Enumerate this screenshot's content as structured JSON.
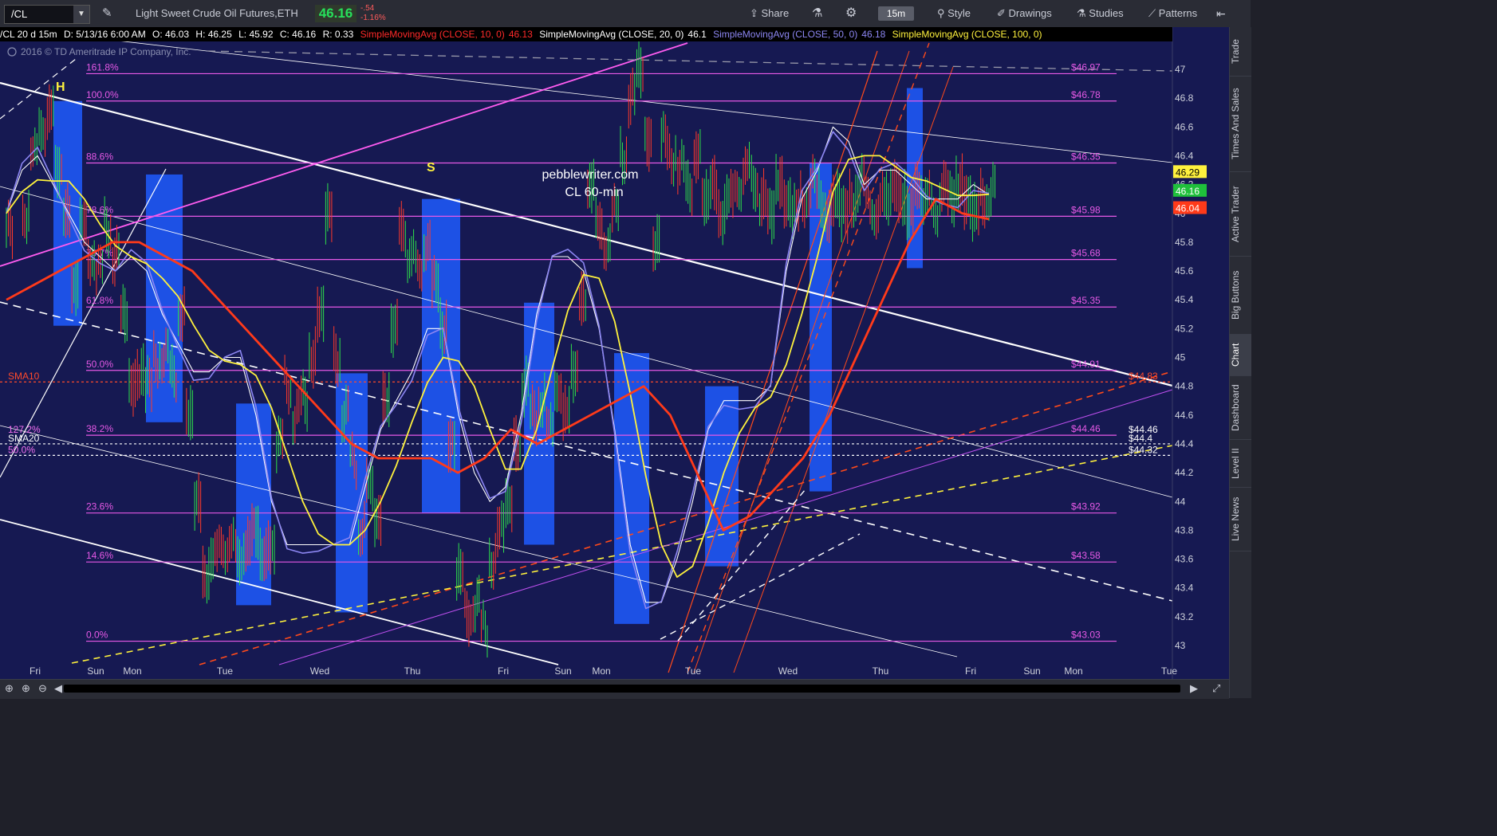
{
  "toolbar": {
    "symbol": "/CL",
    "instrument": "Light Sweet Crude Oil Futures,ETH",
    "last_price": "46.16",
    "net_change": "-.54",
    "pct_change": "-1.16%",
    "share": "Share",
    "timeframe": "15m",
    "style": "Style",
    "drawings": "Drawings",
    "studies": "Studies",
    "patterns": "Patterns"
  },
  "legend": {
    "header": "/CL 20 d 15m",
    "date": "D: 5/13/16 6:00 AM",
    "open": "O: 46.03",
    "high": "H: 46.25",
    "low": "L: 45.92",
    "close": "C: 46.16",
    "range": "R: 0.33",
    "studies": [
      {
        "label": "SimpleMovingAvg (CLOSE, 10, 0)",
        "value": "46.13",
        "color": "#ff2a2a"
      },
      {
        "label": "SimpleMovingAvg (CLOSE, 20, 0)",
        "value": "46.1",
        "color": "#ffffff"
      },
      {
        "label": "SimpleMovingAvg (CLOSE, 50, 0)",
        "value": "46.18",
        "color": "#8c86f2"
      },
      {
        "label": "SimpleMovingAvg (CLOSE, 100, 0)",
        "value": "",
        "color": "#fff23d"
      }
    ]
  },
  "watermark": "2016 © TD Ameritrade IP Company, Inc.",
  "chart_data": {
    "type": "line",
    "title": "pebblewriter.com",
    "subtitle": "CL 60-min",
    "xlabels": [
      "Fri",
      "Sun",
      "Mon",
      "Tue",
      "Wed",
      "Thu",
      "Fri",
      "Sun",
      "Mon",
      "Tue",
      "Wed",
      "Thu",
      "Fri",
      "Sun",
      "Mon",
      "Tue"
    ],
    "ylim": [
      42.85,
      47.25
    ],
    "yticks": [
      43,
      43.2,
      43.4,
      43.6,
      43.8,
      44,
      44.2,
      44.4,
      44.6,
      44.8,
      45,
      45.2,
      45.4,
      45.6,
      45.8,
      46,
      46.2,
      46.4,
      46.6,
      46.8,
      47
    ],
    "price_path_x": [
      0,
      1,
      1.5,
      2,
      2.5,
      3,
      3.5,
      4,
      4.5,
      5,
      5.5,
      6,
      6.5,
      7,
      7.5,
      8,
      8.5,
      9,
      9.5,
      10,
      10.5,
      11,
      11.5,
      12,
      12.5,
      13,
      13.5,
      14,
      14.5,
      15,
      15.5,
      16,
      16.5,
      17,
      17.5,
      18,
      18.5,
      19,
      19.5,
      20,
      20.5,
      21,
      21.5,
      22,
      22.5,
      23,
      23.5,
      24,
      24.5,
      25,
      25.5,
      26,
      26.5,
      27,
      27.5,
      28,
      28.5,
      29,
      29.5,
      30,
      30.5,
      31,
      31.5,
      32,
      32.5,
      33,
      33.5,
      34,
      34.5,
      35,
      35.5,
      36,
      36.5,
      37,
      37.5,
      38,
      38.5,
      39,
      39.5,
      40,
      40.5,
      41,
      41.5,
      42,
      42.5,
      43,
      43.5,
      44,
      44.5,
      45,
      45.5,
      46,
      46.5,
      47,
      47.5,
      48,
      48.5,
      49,
      49.5,
      50,
      50.5,
      51,
      51.5,
      52,
      52.5,
      53,
      53.5,
      54,
      54.5,
      55,
      55.5,
      56,
      56.5,
      57,
      57.5,
      58,
      58.5,
      59,
      59.5,
      60
    ],
    "price_path_y": [
      45.9,
      46.0,
      46.4,
      46.6,
      46.7,
      46.3,
      46.0,
      45.5,
      45.9,
      45.7,
      45.6,
      45.9,
      45.7,
      45.3,
      44.8,
      44.9,
      44.8,
      45.0,
      45.0,
      44.9,
      45.3,
      44.6,
      44.0,
      43.5,
      43.6,
      43.7,
      43.7,
      43.6,
      43.7,
      43.8,
      43.6,
      43.7,
      44.4,
      44.8,
      44.6,
      44.7,
      45.0,
      45.3,
      46.0,
      45.0,
      44.6,
      44.3,
      43.8,
      44.1,
      43.9,
      44.7,
      45.2,
      45.9,
      45.7,
      45.6,
      45.8,
      45.5,
      45.2,
      44.4,
      43.5,
      43.2,
      43.3,
      43.1,
      43.6,
      43.8,
      44.0,
      44.4,
      44.8,
      44.6,
      44.7,
      44.5,
      44.8,
      44.6,
      44.9,
      45.4,
      46.2,
      45.9,
      45.8,
      46.0,
      46.4,
      46.8,
      47.0,
      46.5,
      45.8,
      46.5,
      46.4,
      46.3,
      46.2,
      46.4,
      46.1,
      46.2,
      46.0,
      46.1,
      46.2,
      46.3,
      46.2,
      46.1,
      46.0,
      46.2,
      46.1,
      46.0,
      46.1,
      46.2,
      46.1,
      46.0,
      46.1,
      46.0,
      46.1,
      46.2,
      46.1,
      46.0,
      46.1,
      46.2,
      46.1,
      46.0,
      46.2,
      46.1,
      46.0,
      46.2,
      46.1,
      46.2,
      46.1,
      46.0,
      46.1,
      46.16
    ],
    "sma10_y": [
      46.0,
      46.3,
      46.4,
      46.2,
      46.0,
      45.8,
      45.7,
      45.6,
      45.7,
      45.6,
      45.3,
      45.1,
      44.9,
      44.9,
      45.0,
      45.0,
      44.6,
      44.0,
      43.7,
      43.7,
      43.7,
      43.7,
      43.7,
      44.1,
      44.5,
      44.7,
      44.9,
      45.2,
      45.2,
      44.6,
      44.2,
      44.0,
      44.1,
      44.6,
      45.3,
      45.7,
      45.7,
      45.6,
      45.2,
      44.5,
      43.7,
      43.3,
      43.3,
      43.6,
      44.0,
      44.5,
      44.7,
      44.7,
      44.7,
      44.8,
      45.6,
      46.1,
      46.3,
      46.6,
      46.5,
      46.2,
      46.3,
      46.3,
      46.2,
      46.1,
      46.1,
      46.1,
      46.2,
      46.13
    ],
    "sma100_y": [
      45.4,
      45.5,
      45.6,
      45.7,
      45.8,
      45.8,
      45.7,
      45.6,
      45.4,
      45.2,
      45.0,
      44.8,
      44.6,
      44.4,
      44.3,
      44.3,
      44.3,
      44.2,
      44.3,
      44.5,
      44.4,
      44.5,
      44.6,
      44.7,
      44.8,
      44.6,
      44.2,
      43.8,
      43.9,
      44.1,
      44.3,
      44.6,
      45.0,
      45.4,
      45.8,
      46.1,
      46.0,
      45.96
    ],
    "fib_levels": [
      {
        "pct": "161.8%",
        "value": 46.97,
        "label": "$46.97"
      },
      {
        "pct": "100.0%",
        "value": 46.78,
        "label": "$46.78"
      },
      {
        "pct": "88.6%",
        "value": 46.35,
        "label": "$46.35"
      },
      {
        "pct": "78.6%",
        "value": 45.98,
        "label": "$45.98"
      },
      {
        "pct": "70.7%",
        "value": 45.68,
        "label": "$45.68"
      },
      {
        "pct": "61.8%",
        "value": 45.35,
        "label": "$45.35"
      },
      {
        "pct": "50.0%",
        "value": 44.91,
        "label": "$44.91"
      },
      {
        "pct": "38.2%",
        "value": 44.46,
        "label": "$44.46"
      },
      {
        "pct": "23.6%",
        "value": 43.92,
        "label": "$43.92"
      },
      {
        "pct": "14.6%",
        "value": 43.58,
        "label": "$43.58"
      },
      {
        "pct": "0.0%",
        "value": 43.03,
        "label": "$43.03"
      }
    ],
    "horizontal_markers": [
      {
        "name": "SMA10",
        "value": 44.83,
        "label": "$44.83",
        "color": "#ff4a2a"
      },
      {
        "name": "SMA20",
        "value": 44.4,
        "label": "$44.4",
        "color": "#ffffff"
      },
      {
        "name": "",
        "value": 44.32,
        "label": "$44.32",
        "color": "#ffffff"
      },
      {
        "name": "127.2%",
        "value": 44.46,
        "label": "$44.46",
        "color": "#f070f0"
      },
      {
        "name": "50.0%",
        "value": 44.32,
        "label": "",
        "color": "#f070f0"
      }
    ],
    "price_tags": [
      {
        "value": 46.29,
        "label": "46.29",
        "bg": "#fff23d",
        "fg": "#000"
      },
      {
        "value": 46.16,
        "label": "46.16",
        "bg": "#1fbf3b",
        "fg": "#fff"
      },
      {
        "value": 46.04,
        "label": "46.04",
        "bg": "#ff3a1a",
        "fg": "#fff"
      }
    ],
    "annotations": [
      {
        "text": "H",
        "color": "#fff23d"
      },
      {
        "text": "S",
        "color": "#fff23d"
      }
    ]
  },
  "sidebar_tabs": [
    "Trade",
    "Times And Sales",
    "Active Trader",
    "Big Buttons",
    "Chart",
    "Dashboard",
    "Level II",
    "Live News"
  ],
  "colors": {
    "fib": "#e659e6",
    "sma10": "#ff3a1a",
    "sma20": "#ffffff",
    "sma50": "#8c86f2",
    "sma100": "#fff23d",
    "highlight_box": "#1f5cff",
    "chart_bg": "#161952"
  }
}
